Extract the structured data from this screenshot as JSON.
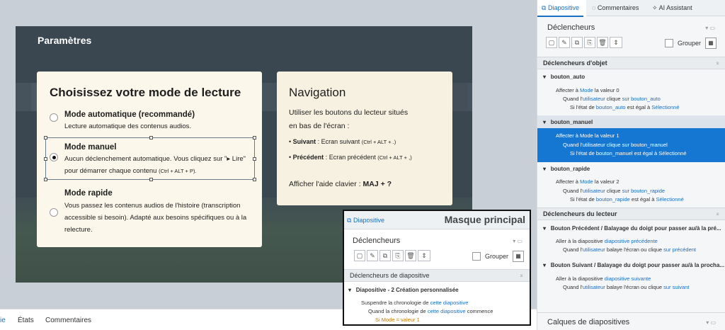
{
  "slide": {
    "title": "Paramètres",
    "mode_card": {
      "heading": "Choisissez votre mode de lecture",
      "options": [
        {
          "title": "Mode automatique (recommandé)",
          "desc": "Lecture automatique des contenus audios."
        },
        {
          "title": "Mode manuel",
          "desc_main": "Aucun déclenchement automatique. Vous cliquez sur \"▸ Lire\" pour démarrer chaque contenu",
          "desc_small": "(Ctrl + ALT + P)."
        },
        {
          "title": "Mode rapide",
          "desc": "Vous passez les contenus audios de l'histoire (transcription accessible si besoin). Adapté aux besoins spécifiques ou à la relecture."
        }
      ]
    },
    "nav_card": {
      "heading": "Navigation",
      "line1": "Utiliser les boutons du lecteur situés",
      "line2": "en bas de l'écran :",
      "next_label": "Suivant",
      "next_text": " : Ecran suivant ",
      "next_keys": "(Ctrl + ALT + .)",
      "prev_label": "Précédent",
      "prev_text": " : Ecran précédent ",
      "prev_keys": "(Ctrl + ALT + ,)",
      "help_text": "Afficher l'aide clavier : ",
      "help_keys": "MAJ + ?"
    }
  },
  "bottom_tabs": [
    "ie",
    "États",
    "Commentaires"
  ],
  "right_panel": {
    "tabs": [
      "Diapositive",
      "Commentaires",
      "AI Assistant"
    ],
    "triggers_title": "Déclencheurs",
    "group_label": "Grouper",
    "object_section": "Déclencheurs d'objet",
    "objects": [
      {
        "name": "bouton_auto",
        "action_pre": "Affecter à ",
        "var": "Mode",
        "action_post": " la valeur 0",
        "when_pre": "Quand l'",
        "who": "utilisateur",
        "when_mid": " clique ",
        "on": "sur bouton_auto",
        "if_pre": "Si l'état de ",
        "if_obj": "bouton_auto",
        "if_post": " est égal à ",
        "if_state": "Sélectionné"
      },
      {
        "name": "bouton_manuel",
        "action_pre": "Affecter à ",
        "var": "Mode",
        "action_post": " la valeur 1",
        "when_pre": "Quand l'",
        "who": "utilisateur",
        "when_mid": " clique ",
        "on": "sur bouton_manuel",
        "if_pre": "Si l'état de ",
        "if_obj": "bouton_manuel",
        "if_post": " est égal à ",
        "if_state": "Sélectionné"
      },
      {
        "name": "bouton_rapide",
        "action_pre": "Affecter à ",
        "var": "Mode",
        "action_post": " la valeur 2",
        "when_pre": "Quand l'",
        "who": "utilisateur",
        "when_mid": " clique ",
        "on": "sur bouton_rapide",
        "if_pre": "Si l'état de ",
        "if_obj": "bouton_rapide",
        "if_post": " est égal à ",
        "if_state": "Sélectionné"
      }
    ],
    "player_section": "Déclencheurs du lecteur",
    "player_triggers": [
      {
        "name": "Bouton Précédent / Balayage du doigt pour passer au/à la pré...",
        "action_pre": "Aller à la diapositive ",
        "target": "diapositive précédente",
        "when_pre": "Quand l'",
        "who": "utilisateur",
        "when_mid": " balaye l'écran ou clique ",
        "on": "sur précédent"
      },
      {
        "name": "Bouton Suivant / Balayage du doigt pour passer au/à la procha...",
        "action_pre": "Aller à la diapositive ",
        "target": "diapositive suivante",
        "when_pre": "Quand l'",
        "who": "utilisateur",
        "when_mid": " balaye l'écran ou clique ",
        "on": "sur suivant"
      }
    ],
    "layers_title": "Calques de diapositives"
  },
  "overlay": {
    "tab": "Diapositive",
    "title": "Masque principal",
    "triggers_title": "Déclencheurs",
    "group_label": "Grouper",
    "section": "Déclencheurs de diapositive",
    "item_name": "Diapositive - 2 Création personnalisée",
    "line1_pre": "Suspendre la chronologie de ",
    "line1_link": "cette diapositive",
    "line2_pre": "Quand la chronologie de ",
    "line2_link": "cette diapositive",
    "line2_post": " commence",
    "line3": "Si Mode = valeur 1"
  }
}
